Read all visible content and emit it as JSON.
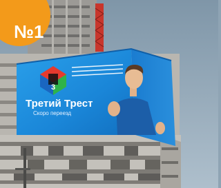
{
  "badge": {
    "label": "№1"
  },
  "billboard": {
    "logo_number": "3",
    "brand_name": "Третий Трест",
    "tagline": "Скоро переезд"
  },
  "colors": {
    "badge_orange": "#f39a1a",
    "screen_blue": "#1f8fe0",
    "sky": "#9fb3c2",
    "concrete": "#bdbab4"
  }
}
